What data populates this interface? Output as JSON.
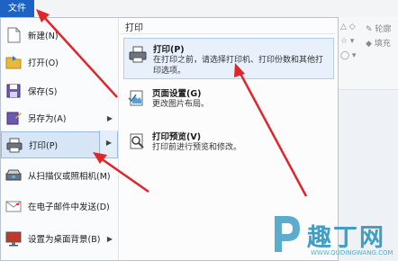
{
  "file_tab": "文件",
  "left_menu": [
    {
      "label": "新建(N)",
      "icon": "new-doc-icon",
      "sub": false
    },
    {
      "label": "打开(O)",
      "icon": "open-folder-icon",
      "sub": false
    },
    {
      "label": "保存(S)",
      "icon": "save-icon",
      "sub": false
    },
    {
      "label": "另存为(A)",
      "icon": "save-as-icon",
      "sub": true
    },
    {
      "label": "打印(P)",
      "icon": "printer-icon",
      "sub": true,
      "selected": true
    },
    {
      "label": "从扫描仪或照相机(M)",
      "icon": "scanner-icon",
      "sub": false
    },
    {
      "label": "在电子邮件中发送(D)",
      "icon": "email-icon",
      "sub": false
    },
    {
      "label": "设置为桌面背景(B)",
      "icon": "desktop-icon",
      "sub": true
    }
  ],
  "right_panel": {
    "title": "打印",
    "options": [
      {
        "title": "打印(P)",
        "desc": "在打印之前，请选择打印机、打印份数和其他打印选项。",
        "icon": "printer-icon",
        "selected": true
      },
      {
        "title": "页面设置(G)",
        "desc": "更改图片布局。",
        "icon": "page-setup-icon"
      },
      {
        "title": "打印预览(V)",
        "desc": "打印前进行预览和修改。",
        "icon": "print-preview-icon"
      }
    ]
  },
  "ribbon": {
    "outline": "轮廓",
    "fill": "填充"
  },
  "watermark": {
    "text": "趣丁网",
    "url": "WWW.QUDINGWANG.COM"
  },
  "colors": {
    "file_tab": "#1e63c4",
    "selection": "#d7e6f7",
    "arrow": "#e0252b",
    "watermark": "#3f9ec4"
  }
}
